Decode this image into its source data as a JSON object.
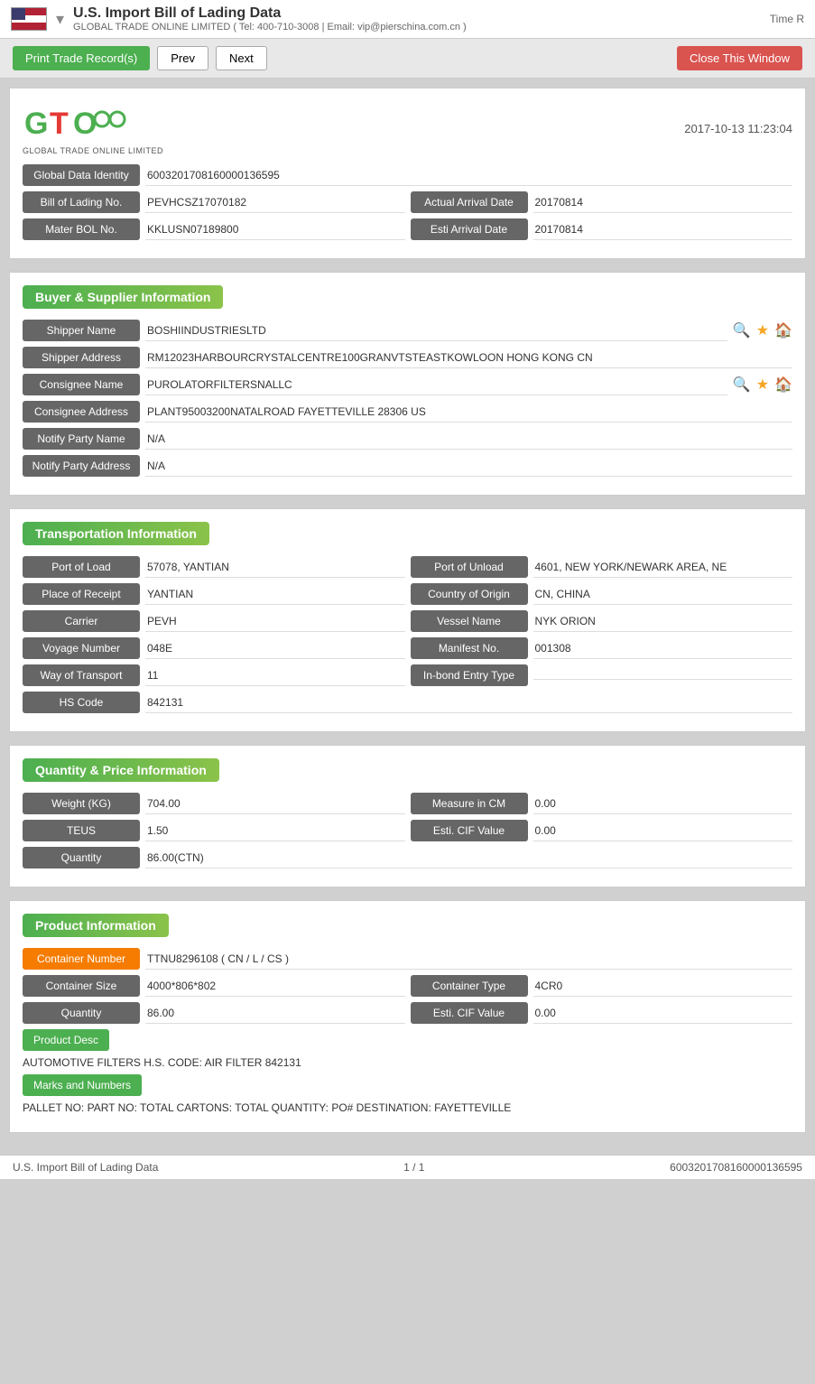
{
  "header": {
    "title": "U.S. Import Bill of Lading Data",
    "subtitle": "GLOBAL TRADE ONLINE LIMITED ( Tel: 400-710-3008 | Email: vip@pierschina.com.cn )",
    "time_label": "Time R",
    "logo_line1": "GTO",
    "logo_company": "GLOBAL TRADE ONLINE LIMITED",
    "record_date": "2017-10-13 11:23:04"
  },
  "toolbar": {
    "print_label": "Print Trade Record(s)",
    "prev_label": "Prev",
    "next_label": "Next",
    "close_label": "Close This Window"
  },
  "global_data": {
    "identity_label": "Global Data Identity",
    "identity_value": "6003201708160000136595",
    "bol_label": "Bill of Lading No.",
    "bol_value": "PEVHCSZ17070182",
    "actual_arrival_label": "Actual Arrival Date",
    "actual_arrival_value": "20170814",
    "master_bol_label": "Mater BOL No.",
    "master_bol_value": "KKLUSN07189800",
    "esti_arrival_label": "Esti Arrival Date",
    "esti_arrival_value": "20170814"
  },
  "buyer_supplier": {
    "section_title": "Buyer & Supplier Information",
    "shipper_name_label": "Shipper Name",
    "shipper_name_value": "BOSHIINDUSTRIESLTD",
    "shipper_address_label": "Shipper Address",
    "shipper_address_value": "RM12023HARBOURCRYSTALCENTRE100GRANVTSTEASTKOWLOON HONG KONG CN",
    "consignee_name_label": "Consignee Name",
    "consignee_name_value": "PUROLATORFILTERSNALLC",
    "consignee_address_label": "Consignee Address",
    "consignee_address_value": "PLANT95003200NATALROAD FAYETTEVILLE 28306 US",
    "notify_party_name_label": "Notify Party Name",
    "notify_party_name_value": "N/A",
    "notify_party_address_label": "Notify Party Address",
    "notify_party_address_value": "N/A"
  },
  "transportation": {
    "section_title": "Transportation Information",
    "port_of_load_label": "Port of Load",
    "port_of_load_value": "57078, YANTIAN",
    "port_of_unload_label": "Port of Unload",
    "port_of_unload_value": "4601, NEW YORK/NEWARK AREA, NE",
    "place_of_receipt_label": "Place of Receipt",
    "place_of_receipt_value": "YANTIAN",
    "country_of_origin_label": "Country of Origin",
    "country_of_origin_value": "CN, CHINA",
    "carrier_label": "Carrier",
    "carrier_value": "PEVH",
    "vessel_name_label": "Vessel Name",
    "vessel_name_value": "NYK ORION",
    "voyage_number_label": "Voyage Number",
    "voyage_number_value": "048E",
    "manifest_no_label": "Manifest No.",
    "manifest_no_value": "001308",
    "way_of_transport_label": "Way of Transport",
    "way_of_transport_value": "11",
    "inbond_entry_label": "In-bond Entry Type",
    "inbond_entry_value": "",
    "hs_code_label": "HS Code",
    "hs_code_value": "842131"
  },
  "quantity_price": {
    "section_title": "Quantity & Price Information",
    "weight_label": "Weight (KG)",
    "weight_value": "704.00",
    "measure_label": "Measure in CM",
    "measure_value": "0.00",
    "teus_label": "TEUS",
    "teus_value": "1.50",
    "esti_cif_label": "Esti. CIF Value",
    "esti_cif_value": "0.00",
    "quantity_label": "Quantity",
    "quantity_value": "86.00(CTN)"
  },
  "product_information": {
    "section_title": "Product Information",
    "container_number_label": "Container Number",
    "container_number_value": "TTNU8296108 ( CN / L / CS )",
    "container_size_label": "Container Size",
    "container_size_value": "4000*806*802",
    "container_type_label": "Container Type",
    "container_type_value": "4CR0",
    "quantity_label": "Quantity",
    "quantity_value": "86.00",
    "esti_cif_label": "Esti. CIF Value",
    "esti_cif_value": "0.00",
    "product_desc_label": "Product Desc",
    "product_desc_text": "AUTOMOTIVE FILTERS H.S. CODE: AIR FILTER 842131",
    "marks_label": "Marks and Numbers",
    "marks_text": "PALLET NO: PART NO: TOTAL CARTONS: TOTAL QUANTITY: PO# DESTINATION: FAYETTEVILLE"
  },
  "footer": {
    "left": "U.S. Import Bill of Lading Data",
    "center": "1 / 1",
    "right": "6003201708160000136595"
  }
}
